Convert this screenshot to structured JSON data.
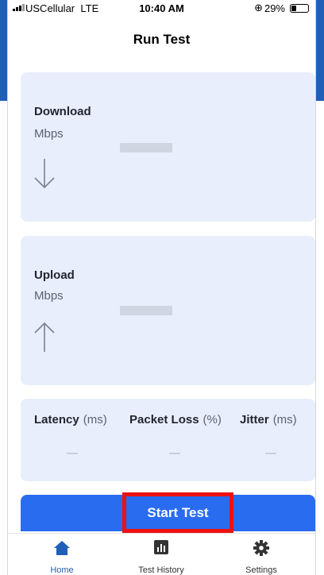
{
  "status_bar": {
    "carrier": "USCellular",
    "network": "LTE",
    "time": "10:40 AM",
    "battery_percent": "29%",
    "battery_level": 0.29
  },
  "header": {
    "title": "Run Test"
  },
  "download": {
    "label": "Download",
    "unit": "Mbps",
    "icon": "arrow-down-icon"
  },
  "upload": {
    "label": "Upload",
    "unit": "Mbps",
    "icon": "arrow-up-icon"
  },
  "metrics": [
    {
      "label": "Latency",
      "unit": "(ms)"
    },
    {
      "label": "Packet Loss",
      "unit": "(%)"
    },
    {
      "label": "Jitter",
      "unit": "(ms)"
    }
  ],
  "start_button": {
    "label": "Start Test"
  },
  "tabbar": {
    "items": [
      {
        "label": "Home",
        "icon": "home-icon",
        "active": true
      },
      {
        "label": "Test History",
        "icon": "chart-icon",
        "active": false
      },
      {
        "label": "Settings",
        "icon": "gear-icon",
        "active": false
      }
    ]
  },
  "colors": {
    "accent": "#2a6cf0",
    "card_bg": "#e8eefb",
    "highlight_border": "#ee1111",
    "tab_active": "#1f5fb8"
  }
}
